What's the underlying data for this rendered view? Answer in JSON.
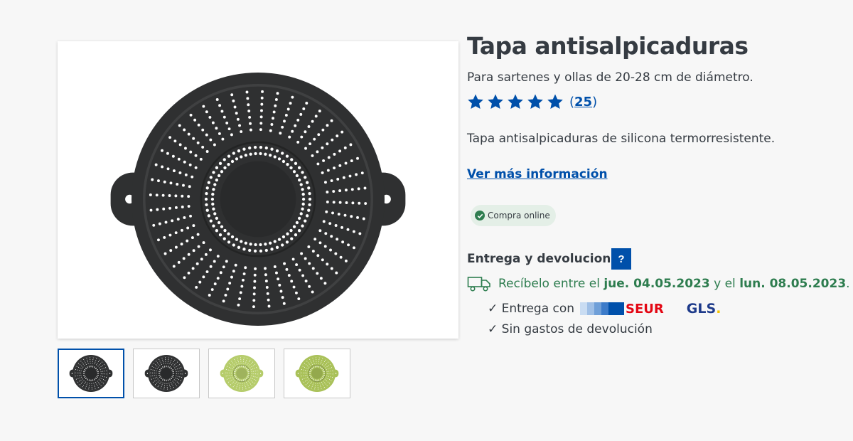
{
  "product": {
    "title": "Tapa antisalpicaduras",
    "subtitle": "Para sartenes y ollas de 20-28 cm de diámetro.",
    "rating": {
      "stars": 5,
      "max": 5,
      "count_display": "25"
    },
    "description": "Tapa antisalpicaduras de silicona termorresistente.",
    "more_info_link": "Ver más información",
    "badge": "Compra online"
  },
  "delivery": {
    "title": "Entrega y devoluciones:",
    "help_label": "?",
    "receive_prefix": "Recíbelo entre el",
    "date_from": "jue. 04.05.2023",
    "middle": "y el",
    "date_to": "lun. 08.05.2023",
    "end": ".",
    "shipping_label": "Entrega con",
    "carrier_1": "SEUR",
    "carrier_2": "GLS",
    "carrier_2_dot": ".",
    "returns_label": "Sin gastos de devolución",
    "check_mark": "✓"
  },
  "gallery": {
    "thumbnails": [
      {
        "color": "#2f3031",
        "active": true
      },
      {
        "color": "#2f3031",
        "active": false
      },
      {
        "color": "#b5cc6a",
        "active": false
      },
      {
        "color": "#a9c158",
        "active": false
      }
    ]
  },
  "colors": {
    "brand_blue": "#0050aa",
    "delivery_green": "#2e7d4f",
    "product_dark": "#2f3031"
  },
  "icons": {
    "star": "star-icon",
    "truck": "truck-icon",
    "check": "check-icon"
  }
}
